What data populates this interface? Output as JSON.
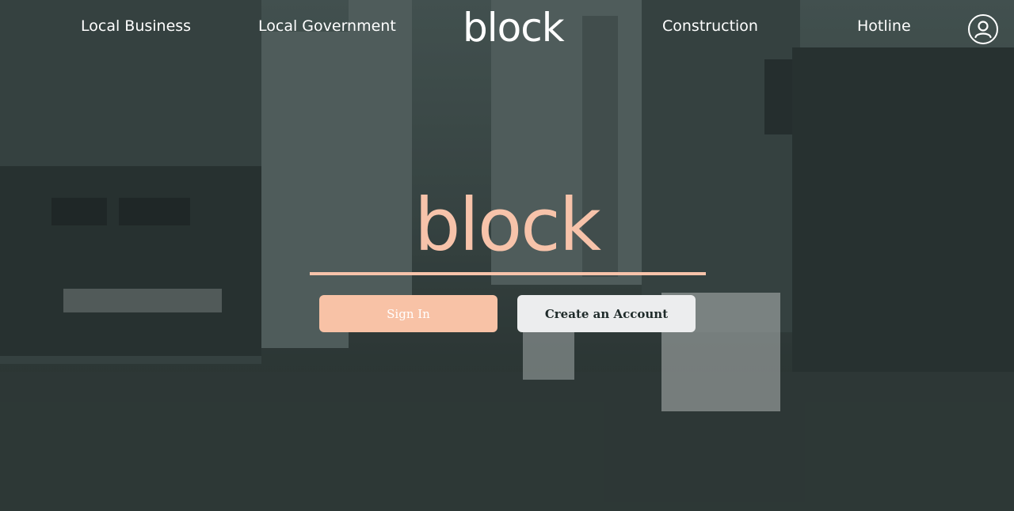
{
  "nav": {
    "links": [
      "Local Business",
      "Local Government",
      "Construction",
      "Hotline"
    ],
    "logo": "block",
    "profile_icon": "user-circle-icon"
  },
  "hero": {
    "title": "block",
    "signin_label": "Sign In",
    "create_label": "Create an Account"
  },
  "colors": {
    "accent": "#f7c3aa",
    "button_secondary": "#ecedee",
    "overlay": "#3c4947",
    "nav_text": "#ffffff"
  }
}
